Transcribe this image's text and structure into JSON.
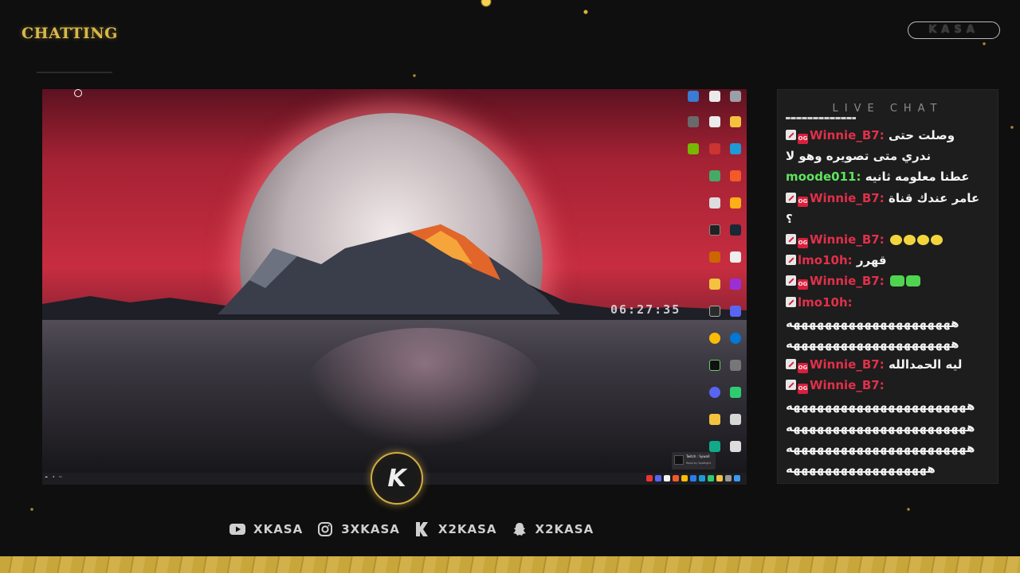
{
  "header": {
    "brand_title": "CHATTING",
    "kasa_pill": "KASA"
  },
  "screen": {
    "clock": "06:27:35",
    "recycle_label": "",
    "notification": {
      "title": "Twitch : Sywa0",
      "subtitle": "Read by Spotlight"
    }
  },
  "logo": {
    "letter": "K"
  },
  "socials": [
    {
      "icon": "youtube-icon",
      "label": "XKASA"
    },
    {
      "icon": "instagram-icon",
      "label": "3XKASA"
    },
    {
      "icon": "kick-icon",
      "label": "X2KASA"
    },
    {
      "icon": "snapchat-icon",
      "label": "X2KASA"
    }
  ],
  "chat": {
    "title": "LIVE CHAT",
    "lines": [
      {
        "user": "Winnie_B7:",
        "text": "وصلت حتى",
        "badges": true,
        "color": "red"
      },
      {
        "user": "",
        "text": "ندري متى تصويره وهو لا",
        "badges": false,
        "color": ""
      },
      {
        "user": "moode011:",
        "text": "عطنا معلومه ثانيه",
        "badges": false,
        "color": "green"
      },
      {
        "user": "Winnie_B7:",
        "text": "عامر عندك قناة",
        "badges": true,
        "color": "red"
      },
      {
        "user": "",
        "text": "؟",
        "badges": false,
        "color": ""
      },
      {
        "user": "Winnie_B7:",
        "text": "",
        "badges": true,
        "color": "red",
        "emotes": 4
      },
      {
        "user": "lmo10h:",
        "text": "قهرر",
        "badges": "mod",
        "color": "red"
      },
      {
        "user": "Winnie_B7:",
        "text": "",
        "badges": true,
        "color": "red",
        "emotes_green": 2
      },
      {
        "user": "lmo10h:",
        "text": "",
        "badges": "mod",
        "color": "red"
      },
      {
        "user": "",
        "text": "هههههههههههههههههههههه",
        "badges": false,
        "color": ""
      },
      {
        "user": "",
        "text": "هههههههههههههههههههههه",
        "badges": false,
        "color": ""
      },
      {
        "user": "Winnie_B7:",
        "text": "ليه الحمدالله",
        "badges": true,
        "color": "red"
      },
      {
        "user": "Winnie_B7:",
        "text": "",
        "badges": true,
        "color": "red"
      },
      {
        "user": "",
        "text": "هههههههههههههههههههههههه",
        "badges": false,
        "color": ""
      },
      {
        "user": "",
        "text": "هههههههههههههههههههههههه",
        "badges": false,
        "color": ""
      },
      {
        "user": "",
        "text": "هههههههههههههههههههههههه",
        "badges": false,
        "color": ""
      },
      {
        "user": "",
        "text": "ههههههههههههههههههه",
        "badges": false,
        "color": ""
      }
    ]
  },
  "colors": {
    "gold": "#cfae44",
    "chat_red": "#e1304a",
    "chat_green": "#5fe35f",
    "chat_bg": "#1d1d1d"
  }
}
